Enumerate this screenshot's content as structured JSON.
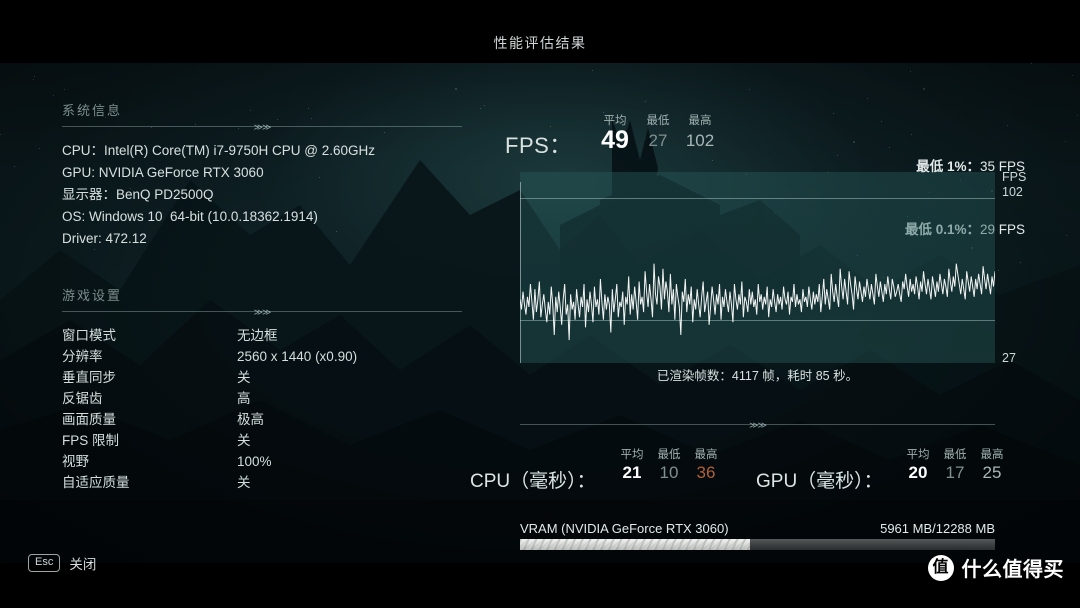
{
  "title": "性能评估结果",
  "system_info": {
    "heading": "系统信息",
    "lines": [
      "CPU：Intel(R) Core(TM) i7-9750H CPU @ 2.60GHz",
      "GPU: NVIDIA GeForce RTX 3060",
      "显示器：BenQ PD2500Q",
      "OS: Windows 10  64-bit (10.0.18362.1914)",
      "Driver: 472.12"
    ]
  },
  "game_settings": {
    "heading": "游戏设置",
    "rows": [
      {
        "name": "窗口模式",
        "value": "无边框"
      },
      {
        "name": "分辨率",
        "value": "2560 x 1440 (x0.90)"
      },
      {
        "name": "垂直同步",
        "value": "关"
      },
      {
        "name": "反锯齿",
        "value": "高"
      },
      {
        "name": "画面质量",
        "value": "极高"
      },
      {
        "name": "FPS 限制",
        "value": "关"
      },
      {
        "name": "视野",
        "value": "100%"
      },
      {
        "name": "自适应质量",
        "value": "关"
      }
    ]
  },
  "fps": {
    "label": "FPS：",
    "headers": {
      "avg": "平均",
      "min": "最低",
      "max": "最高"
    },
    "avg": "49",
    "min": "27",
    "max": "102",
    "low_1_label": "最低 1%：",
    "low_1_value": "35 FPS",
    "low_01_label": "最低 0.1%：",
    "low_01_value": "29 FPS"
  },
  "chart_data": {
    "type": "line",
    "title": "FPS",
    "xlabel": "",
    "ylabel": "FPS",
    "ylim": [
      27,
      102
    ],
    "axis_top_label": "FPS",
    "axis_top_value": "102",
    "axis_bottom_value": "27",
    "gridlines": [
      2
    ],
    "grid": true,
    "legend": "none",
    "series": [
      {
        "name": "FPS over time",
        "values": [
          52,
          48,
          55,
          50,
          46,
          53,
          49,
          58,
          51,
          44,
          56,
          47,
          52,
          59,
          45,
          50,
          54,
          48,
          43,
          51,
          46,
          57,
          50,
          38,
          53,
          47,
          55,
          49,
          42,
          52,
          58,
          46,
          50,
          36,
          54,
          48,
          51,
          44,
          56,
          50,
          45,
          53,
          49,
          58,
          41,
          52,
          47,
          55,
          50,
          43,
          57,
          49,
          52,
          46,
          60,
          51,
          44,
          54,
          48,
          53,
          50,
          39,
          56,
          47,
          52,
          58,
          45,
          51,
          49,
          55,
          42,
          53,
          50,
          61,
          46,
          54,
          48,
          57,
          51,
          44,
          59,
          50,
          53,
          47,
          63,
          55,
          49,
          58,
          52,
          45,
          66,
          54,
          50,
          61,
          57,
          48,
          64,
          52,
          59,
          55,
          47,
          62,
          50,
          56,
          44,
          58,
          53,
          49,
          38,
          55,
          51,
          60,
          47,
          54,
          50,
          57,
          43,
          52,
          48,
          56,
          50,
          45,
          53,
          59,
          47,
          51,
          55,
          42,
          49,
          57,
          52,
          46,
          54,
          50,
          58,
          44,
          53,
          49,
          56,
          51,
          47,
          55,
          50,
          43,
          58,
          52,
          48,
          54,
          50,
          59,
          45,
          53,
          51,
          47,
          56,
          50,
          55,
          49,
          52,
          46,
          58,
          51,
          54,
          48,
          53,
          50,
          57,
          45,
          52,
          49,
          56,
          51,
          47,
          54,
          50,
          53,
          48,
          57,
          52,
          50,
          55,
          46,
          53,
          51,
          58,
          49,
          54,
          50,
          52,
          47,
          56,
          51,
          53,
          49,
          57,
          52,
          48,
          55,
          50,
          54,
          51,
          58,
          47,
          53,
          60,
          50,
          56,
          52,
          48,
          62,
          55,
          51,
          58,
          53,
          49,
          64,
          57,
          52,
          60,
          55,
          50,
          63,
          58,
          54,
          48,
          61,
          56,
          52,
          59,
          55,
          51,
          57,
          53,
          60,
          56,
          52,
          58,
          54,
          50,
          62,
          57,
          53,
          59,
          55,
          51,
          58,
          54,
          61,
          56,
          52,
          60,
          57,
          53,
          55,
          58,
          54,
          51,
          59,
          56,
          62,
          57,
          53,
          60,
          55,
          58,
          54,
          61,
          57,
          52,
          59,
          55,
          63,
          58,
          54,
          60,
          56,
          52,
          61,
          57,
          53,
          59,
          55,
          62,
          58,
          54,
          60,
          57,
          53,
          64,
          59,
          55,
          61,
          57,
          66,
          62,
          58,
          54,
          60,
          56,
          52,
          63,
          59,
          55,
          61,
          57,
          53,
          60,
          56,
          62,
          58,
          54,
          65,
          60,
          56,
          62,
          58,
          54,
          61,
          57,
          63
        ]
      }
    ],
    "footer": "已渲染帧数：4117 帧，耗时 85 秒。"
  },
  "frame_times": {
    "cpu": {
      "label": "CPU（毫秒）：",
      "headers": {
        "avg": "平均",
        "min": "最低",
        "max": "最高"
      },
      "avg": "21",
      "min": "10",
      "max": "36"
    },
    "gpu": {
      "label": "GPU（毫秒）：",
      "headers": {
        "avg": "平均",
        "min": "最低",
        "max": "最高"
      },
      "avg": "20",
      "min": "17",
      "max": "25"
    }
  },
  "vram": {
    "label": "VRAM (NVIDIA GeForce RTX 3060)",
    "value": "5961 MB/12288 MB",
    "fill_percent": 48.5
  },
  "footer": {
    "esc_key": "Esc",
    "close_label": "关闭"
  },
  "watermark": {
    "logo": "值",
    "text": "什么值得买"
  },
  "colors": {
    "accent_hot": "#b0603a",
    "chart_line": "#ffffff",
    "chart_fill": "#2a5c5c",
    "text": "#d5dedd"
  }
}
